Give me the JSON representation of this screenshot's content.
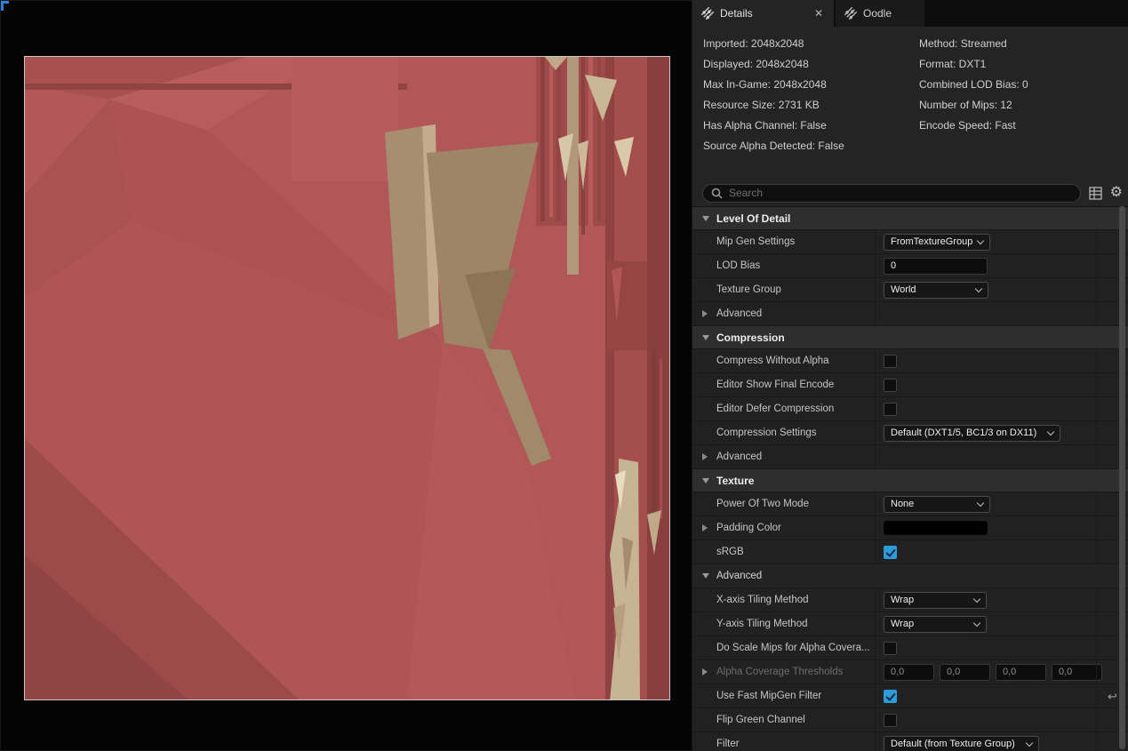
{
  "colors": {
    "checkbox_checked": "#2e9ad8",
    "accent_blue": "#2f7fd8",
    "texture_base": "#b15757"
  },
  "icons": {
    "close": "✕",
    "gear": "⚙",
    "reset": "↩"
  },
  "tabs": {
    "details": {
      "label": "Details"
    },
    "oodle": {
      "label": "Oodle"
    }
  },
  "info": {
    "left": [
      "Imported: 2048x2048",
      "Displayed: 2048x2048",
      "Max In-Game: 2048x2048",
      "Resource Size: 2731 KB",
      "Has Alpha Channel: False",
      "Source Alpha Detected: False"
    ],
    "right": [
      "Method: Streamed",
      "Format: DXT1",
      "Combined LOD Bias: 0",
      "Number of Mips: 12",
      "Encode Speed: Fast"
    ]
  },
  "search": {
    "placeholder": "Search"
  },
  "sections": {
    "lod": {
      "title": "Level Of Detail",
      "rows": {
        "mip_gen": {
          "label": "Mip Gen Settings",
          "value": "FromTextureGroup"
        },
        "lod_bias": {
          "label": "LOD Bias",
          "value": "0"
        },
        "texture_group": {
          "label": "Texture Group",
          "value": "World"
        },
        "advanced": {
          "label": "Advanced"
        }
      }
    },
    "compression": {
      "title": "Compression",
      "rows": {
        "without_alpha": {
          "label": "Compress Without Alpha",
          "checked": false
        },
        "show_final": {
          "label": "Editor Show Final Encode",
          "checked": false
        },
        "defer": {
          "label": "Editor Defer Compression",
          "checked": false
        },
        "settings": {
          "label": "Compression Settings",
          "value": "Default (DXT1/5, BC1/3 on DX11)"
        },
        "advanced": {
          "label": "Advanced"
        }
      }
    },
    "texture": {
      "title": "Texture",
      "rows": {
        "pot": {
          "label": "Power Of Two Mode",
          "value": "None"
        },
        "padding": {
          "label": "Padding Color",
          "value_hex": "#000000"
        },
        "srgb": {
          "label": "sRGB",
          "checked": true
        }
      }
    },
    "advanced": {
      "title": "Advanced",
      "rows": {
        "x_tiling": {
          "label": "X-axis Tiling Method",
          "value": "Wrap"
        },
        "y_tiling": {
          "label": "Y-axis Tiling Method",
          "value": "Wrap"
        },
        "scale_mips": {
          "label": "Do Scale Mips for Alpha Covera...",
          "checked": false
        },
        "alpha_thresholds": {
          "label": "Alpha Coverage Thresholds",
          "values": [
            "0,0",
            "0,0",
            "0,0",
            "0,0"
          ]
        },
        "fast_mipgen": {
          "label": "Use Fast MipGen Filter",
          "checked": true
        },
        "flip_green": {
          "label": "Flip Green Channel",
          "checked": false
        },
        "filter": {
          "label": "Filter",
          "value": "Default (from Texture Group)"
        }
      }
    }
  }
}
